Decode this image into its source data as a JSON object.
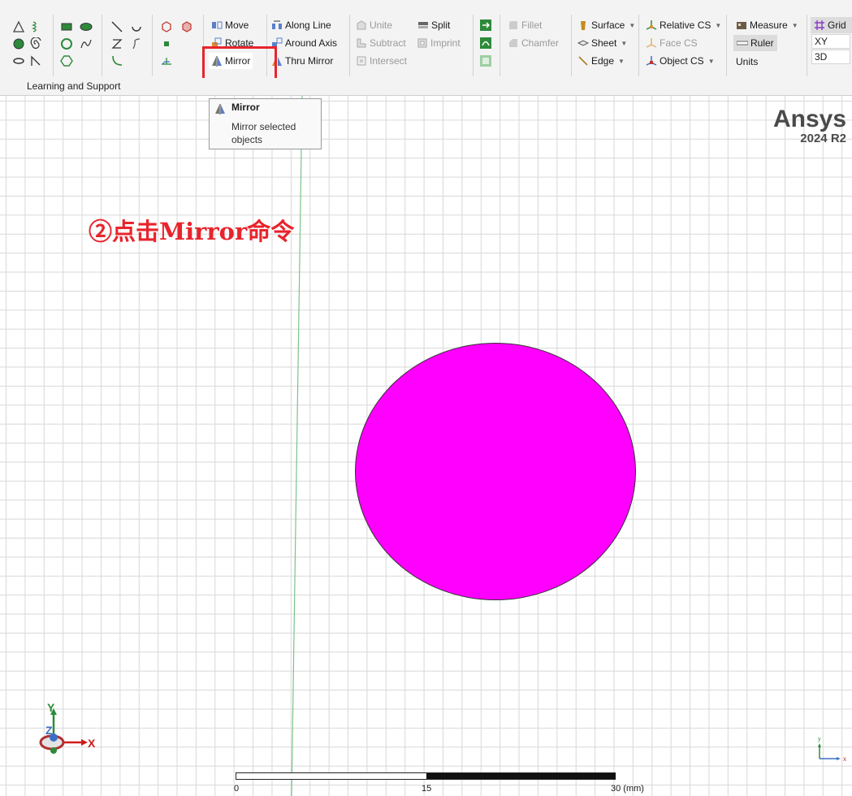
{
  "toolbar": {
    "transform": {
      "move": "Move",
      "rotate": "Rotate",
      "mirror": "Mirror"
    },
    "duplicate": {
      "along_line": "Along Line",
      "around_axis": "Around Axis",
      "thru_mirror": "Thru Mirror"
    },
    "boolean": {
      "unite": "Unite",
      "split": "Split",
      "subtract": "Subtract",
      "imprint": "Imprint",
      "intersect": "Intersect"
    },
    "edit": {
      "fillet": "Fillet",
      "chamfer": "Chamfer"
    },
    "surface": {
      "surface": "Surface",
      "sheet": "Sheet",
      "edge": "Edge"
    },
    "cs": {
      "relative": "Relative CS",
      "face": "Face CS",
      "object": "Object CS"
    },
    "measure": {
      "measure": "Measure",
      "ruler": "Ruler",
      "units": "Units"
    },
    "grid": {
      "grid": "Grid",
      "xy": "XY",
      "three_d": "3D"
    }
  },
  "learning_tab": "Learning and Support",
  "tooltip": {
    "title": "Mirror",
    "description": "Mirror selected objects"
  },
  "annotation": "②点击Mirror命令",
  "brand": {
    "name": "Ansys",
    "version": "2024 R2"
  },
  "axis_triad": {
    "x": "X",
    "y": "Y",
    "z": "Z"
  },
  "small_triad": {
    "x": "x",
    "y": "y"
  },
  "scale_bar": {
    "start": "0",
    "mid": "15",
    "end": "30 (mm)"
  },
  "colors": {
    "accent_red": "#e8242c",
    "object_fill": "#ff00ff",
    "grid_line": "#d8d8d8"
  }
}
